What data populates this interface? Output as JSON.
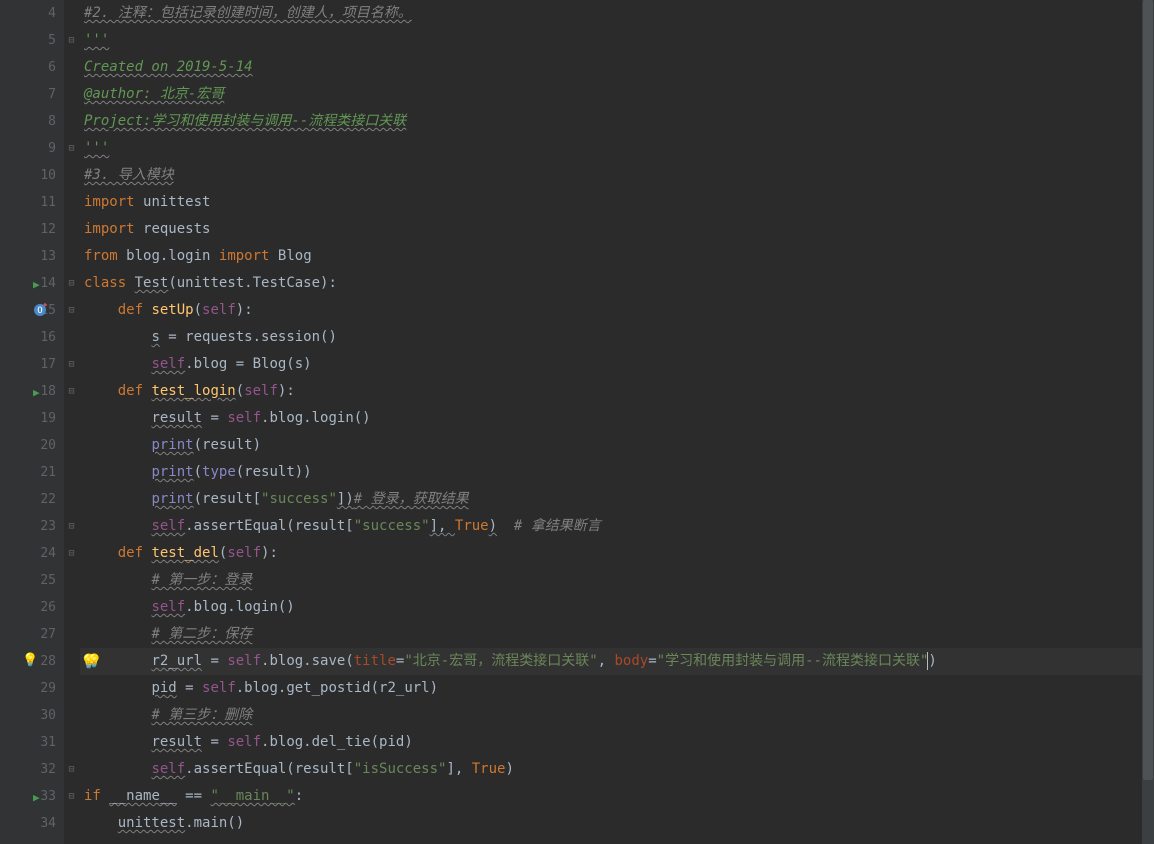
{
  "line_start": 4,
  "line_end": 34,
  "highlighted_line_index": 24,
  "code": {
    "l4": {
      "comment": "#2. 注释：包括记录创建时间，创建人，项目名称。"
    },
    "l5": {
      "doc": "'''"
    },
    "l6": {
      "doc": "Created on 2019-5-14"
    },
    "l7": {
      "doc": "@author: 北京-宏哥"
    },
    "l8": {
      "doc": "Project:学习和使用封装与调用--流程类接口关联"
    },
    "l9": {
      "doc": "'''"
    },
    "l10": {
      "comment": "#3. 导入模块"
    },
    "l11": {
      "kw1": "import",
      "id1": "unittest"
    },
    "l12": {
      "kw1": "import",
      "id1": "requests"
    },
    "l13": {
      "kw1": "from",
      "id1": "blog.login",
      "kw2": "import",
      "id2": "Blog"
    },
    "l14": {
      "kw1": "class",
      "cls": "Test",
      "base": "unittest.TestCase"
    },
    "l15": {
      "kw1": "def",
      "fn": "setUp",
      "self": "self"
    },
    "l16": {
      "var": "s",
      "call": "requests.session()"
    },
    "l17": {
      "self": "self",
      "attr": ".blog = Blog(s)"
    },
    "l18": {
      "kw1": "def",
      "fn": "test_login",
      "self": "self"
    },
    "l19": {
      "var": "result",
      "expr_self": "self",
      "expr_rest": ".blog.login()"
    },
    "l20": {
      "builtin": "print",
      "arg": "(result)"
    },
    "l21": {
      "builtin": "print",
      "arg_pre": "(",
      "type_kw": "type",
      "arg_post": "(result))"
    },
    "l22": {
      "builtin": "print",
      "pre": "(result[",
      "str": "\"success\"",
      "post": "])",
      "cmt": "# 登录，获取结果"
    },
    "l23": {
      "self": "self",
      "mid": ".assertEqual(result[",
      "str": "\"success\"",
      "mid2": "], ",
      "true": "True",
      "post": ")",
      "cmt": "# 拿结果断言"
    },
    "l24": {
      "kw1": "def",
      "fn": "test_del",
      "self": "self"
    },
    "l25": {
      "cmt": "# 第一步：登录"
    },
    "l26": {
      "self": "self",
      "rest": ".blog.login()"
    },
    "l27": {
      "cmt": "# 第二步：保存"
    },
    "l28": {
      "var": "r2_url",
      "eq": " = ",
      "self": "self",
      "mid": ".blog.save(",
      "p1": "title",
      "eq1": "=",
      "s1": "\"北京-宏哥，流程类接口关联\"",
      "comma": ", ",
      "p2": "body",
      "eq2": "=",
      "s2": "\"学习和使用封装与调用--流程类接口关联\"",
      "close": ")"
    },
    "l29": {
      "var": "pid",
      "eq": " = ",
      "self": "self",
      "rest": ".blog.get_postid(r2_url)"
    },
    "l30": {
      "cmt": "# 第三步：删除"
    },
    "l31": {
      "var": "result",
      "eq": " = ",
      "self": "self",
      "rest": ".blog.del_tie(pid)"
    },
    "l32": {
      "self": "self",
      "mid": ".assertEqual(result[",
      "str": "\"isSuccess\"",
      "mid2": "], ",
      "true": "True",
      "post": ")"
    },
    "l33": {
      "kw1": "if",
      "name": "__name__",
      "eq": " == ",
      "str": "\"__main__\"",
      "colon": ":"
    },
    "l34": {
      "id": "unittest",
      "call": ".main()"
    }
  },
  "gutter_icons": {
    "run_lines": [
      14,
      18,
      33
    ],
    "override_line": 15,
    "bulb_line": 28
  }
}
